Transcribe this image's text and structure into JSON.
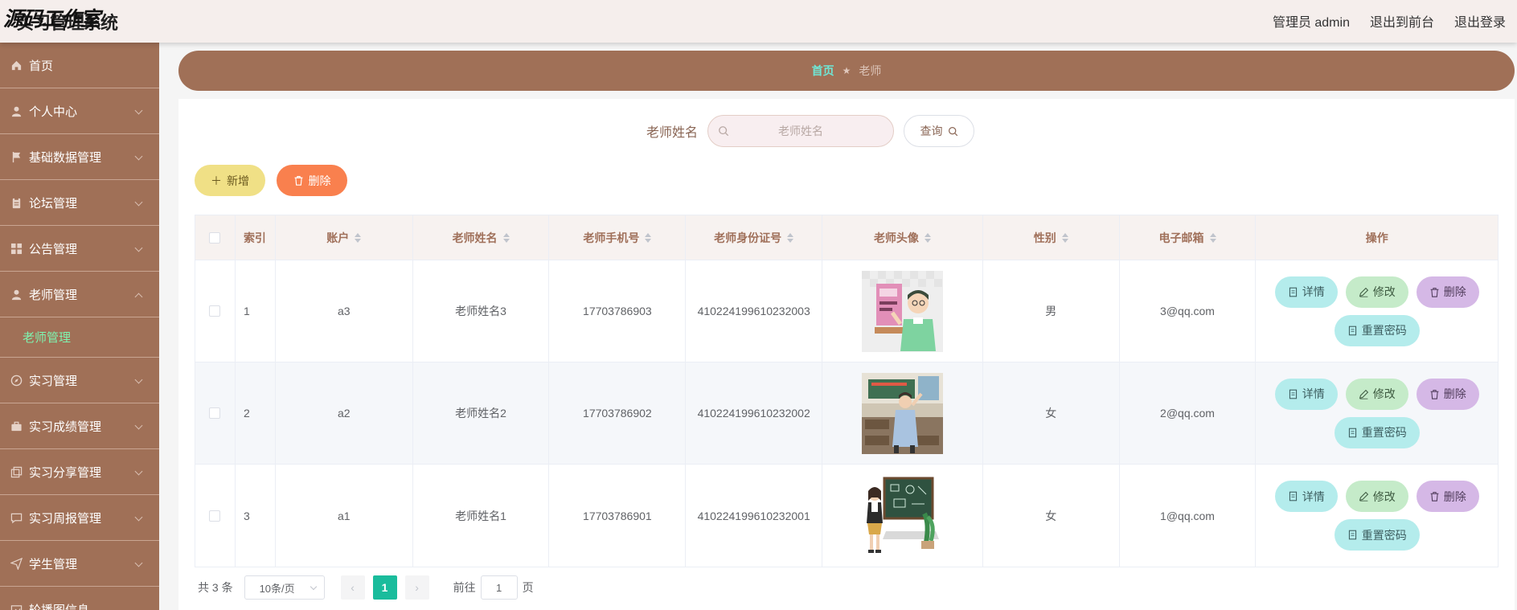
{
  "header": {
    "brand_overlay": "源码工作室",
    "title": "实习管理系统",
    "admin_label": "管理员 admin",
    "back_front": "退出到前台",
    "logout": "退出登录"
  },
  "sidebar": {
    "items": [
      {
        "label": "首页",
        "icon": "home-icon"
      },
      {
        "label": "个人中心",
        "icon": "user-icon"
      },
      {
        "label": "基础数据管理",
        "icon": "flag-icon"
      },
      {
        "label": "论坛管理",
        "icon": "clipboard-icon"
      },
      {
        "label": "公告管理",
        "icon": "grid-icon"
      },
      {
        "label": "老师管理",
        "icon": "user-icon",
        "expanded": true
      },
      {
        "label": "实习管理",
        "icon": "compass-icon"
      },
      {
        "label": "实习成绩管理",
        "icon": "briefcase-icon"
      },
      {
        "label": "实习分享管理",
        "icon": "copy-icon"
      },
      {
        "label": "实习周报管理",
        "icon": "chat-icon"
      },
      {
        "label": "学生管理",
        "icon": "send-icon"
      },
      {
        "label": "轮播图信息",
        "icon": "image-icon"
      }
    ],
    "submenu_active": "老师管理"
  },
  "breadcrumb": {
    "home": "首页",
    "current": "老师"
  },
  "search": {
    "label": "老师姓名",
    "placeholder": "老师姓名",
    "value": "",
    "button": "查询"
  },
  "actions": {
    "add": "新增",
    "delete": "删除"
  },
  "table": {
    "columns": {
      "index": "索引",
      "account": "账户",
      "name": "老师姓名",
      "phone": "老师手机号",
      "id_card": "老师身份证号",
      "avatar": "老师头像",
      "gender": "性别",
      "email": "电子邮箱",
      "ops": "操作"
    },
    "rows": [
      {
        "index": "1",
        "account": "a3",
        "name": "老师姓名3",
        "phone": "17703786903",
        "id_card": "410224199610232003",
        "gender": "男",
        "email": "3@qq.com"
      },
      {
        "index": "2",
        "account": "a2",
        "name": "老师姓名2",
        "phone": "17703786902",
        "id_card": "410224199610232002",
        "gender": "女",
        "email": "2@qq.com"
      },
      {
        "index": "3",
        "account": "a1",
        "name": "老师姓名1",
        "phone": "17703786901",
        "id_card": "410224199610232001",
        "gender": "女",
        "email": "1@qq.com"
      }
    ],
    "row_ops": {
      "detail": "详情",
      "edit": "修改",
      "delete": "删除",
      "reset": "重置密码"
    }
  },
  "pagination": {
    "total": "共 3 条",
    "page_size": "10条/页",
    "current_page": "1",
    "goto_prefix": "前往",
    "goto_value": "1",
    "goto_suffix": "页"
  },
  "colors": {
    "sidebar": "#a07057",
    "accent_green": "#1abc9c",
    "header_bg": "#f5eeec"
  }
}
